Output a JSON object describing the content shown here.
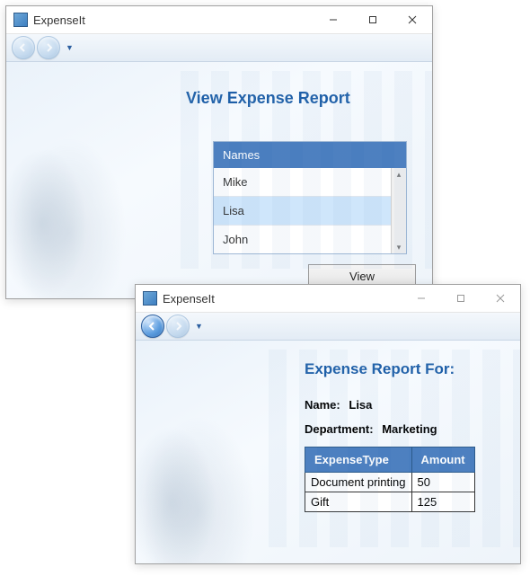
{
  "colors": {
    "accent": "#4a7ebf",
    "heading": "#1e5fa8"
  },
  "window1": {
    "title": "ExpenseIt",
    "heading": "View Expense Report",
    "list_header": "Names",
    "items": [
      "Mike",
      "Lisa",
      "John"
    ],
    "selected_index": 1,
    "view_button": "View"
  },
  "window2": {
    "title": "ExpenseIt",
    "heading": "Expense Report For:",
    "name_label": "Name:",
    "name_value": "Lisa",
    "dept_label": "Department:",
    "dept_value": "Marketing",
    "table": {
      "col_type": "ExpenseType",
      "col_amount": "Amount",
      "rows": [
        {
          "type": "Document printing",
          "amount": "50"
        },
        {
          "type": "Gift",
          "amount": "125"
        }
      ]
    }
  }
}
